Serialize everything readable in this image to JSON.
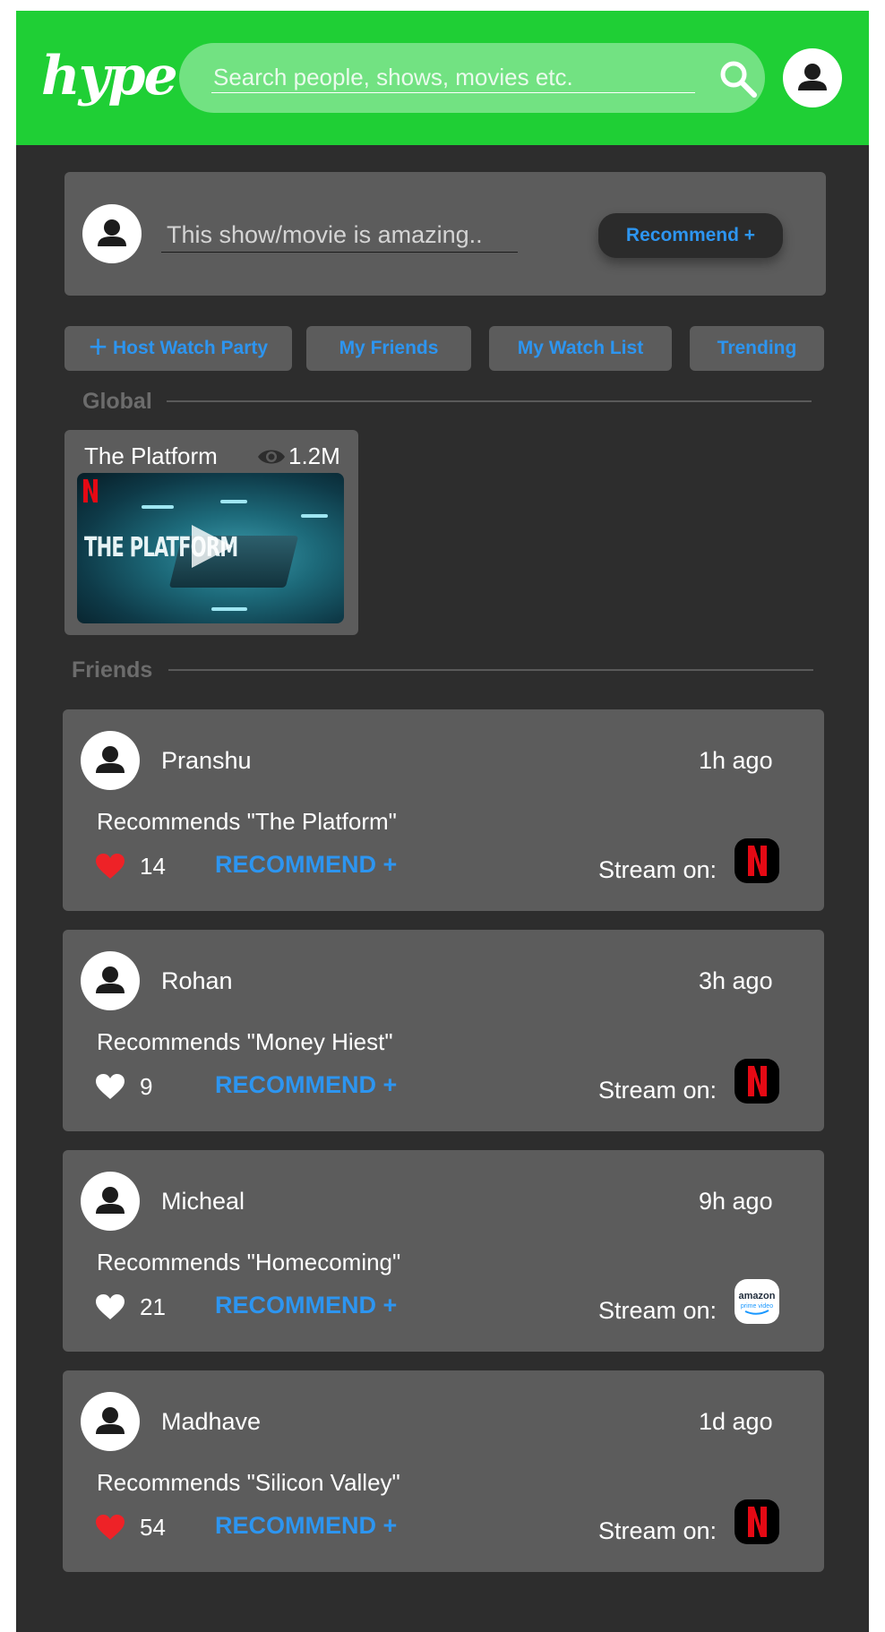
{
  "header": {
    "logo": "hype",
    "search_placeholder": "Search people, shows, movies etc.",
    "icons": {
      "search": "search-icon",
      "profile": "user-icon"
    },
    "colors": {
      "brand": "#1fcf35"
    }
  },
  "compose": {
    "placeholder": "This show/movie is amazing..",
    "button_label": "Recommend +"
  },
  "filters": [
    {
      "label": "Host Watch Party",
      "icon": "plus-icon"
    },
    {
      "label": "My Friends"
    },
    {
      "label": "My Watch List"
    },
    {
      "label": "Trending"
    }
  ],
  "global": {
    "section_title": "Global",
    "card": {
      "title": "The Platform",
      "views": "1.2M",
      "thumbnail_text": "THE PLATFORM",
      "icons": [
        "eye-icon",
        "play-icon",
        "netflix-icon"
      ]
    }
  },
  "friends": {
    "section_title": "Friends",
    "recommend_label": "RECOMMEND +",
    "stream_label": "Stream on:",
    "items": [
      {
        "name": "Pranshu",
        "time": "1h ago",
        "text": "Recommends \"The Platform\"",
        "likes": "14",
        "liked": true,
        "service": "netflix"
      },
      {
        "name": "Rohan",
        "time": "3h ago",
        "text": "Recommends \"Money Hiest\"",
        "likes": "9",
        "liked": false,
        "service": "netflix"
      },
      {
        "name": "Micheal",
        "time": "9h ago",
        "text": "Recommends \"Homecoming\"",
        "likes": "21",
        "liked": false,
        "service": "amazon"
      },
      {
        "name": "Madhave",
        "time": "1d ago",
        "text": "Recommends \"Silicon Valley\"",
        "likes": "54",
        "liked": true,
        "service": "netflix"
      }
    ]
  },
  "colors": {
    "accent": "#2d95f0",
    "liked": "#ee2227",
    "card": "#5c5c5c",
    "background": "#2d2d2d"
  }
}
